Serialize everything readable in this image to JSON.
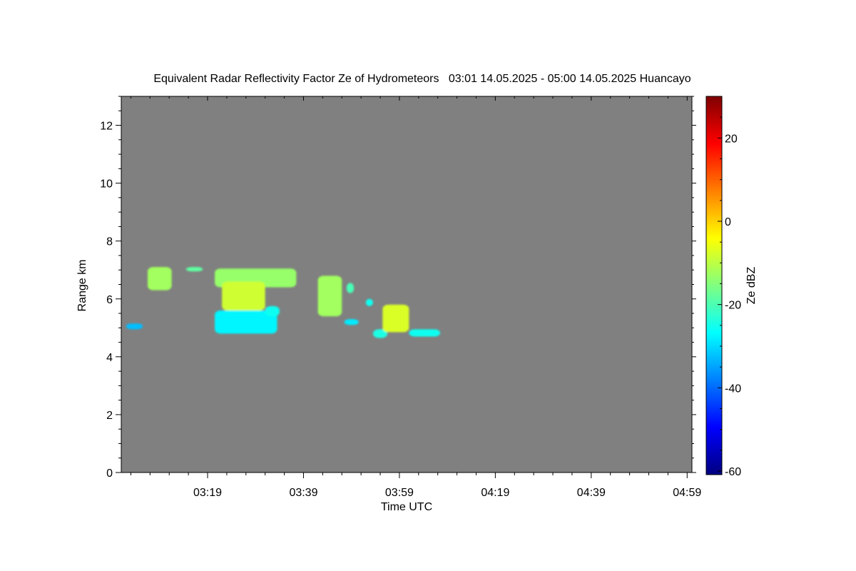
{
  "chart_data": {
    "type": "heatmap",
    "title": "Equivalent Radar Reflectivity Factor Ze of Hydrometeors   03:01 14.05.2025 - 05:00 14.05.2025 Huancayo",
    "xlabel": "Time UTC",
    "ylabel": "Range km",
    "x_ticks": [
      "03:19",
      "03:39",
      "03:59",
      "04:19",
      "04:39",
      "04:59"
    ],
    "x_tick_minutes": [
      18,
      38,
      58,
      78,
      98,
      118
    ],
    "xlim_minutes": [
      0,
      119
    ],
    "ylim": [
      0,
      13
    ],
    "y_ticks": [
      0,
      2,
      4,
      6,
      8,
      10,
      12
    ],
    "y_tick_labels": [
      "0",
      "2",
      "4",
      "6",
      "8",
      "10",
      "12"
    ],
    "colorbar": {
      "label": "Ze dBZ",
      "range": [
        -60,
        30
      ],
      "ticks": [
        -60,
        -40,
        -20,
        0,
        20
      ],
      "tick_labels": [
        "-60",
        "-40",
        "-20",
        "0",
        "20"
      ],
      "colormap": "jet"
    },
    "background_color": "#808080",
    "echoes": [
      {
        "t0": 5.5,
        "t1": 10.5,
        "r0": 6.3,
        "r1": 7.1,
        "dbz": -12
      },
      {
        "t0": 13.5,
        "t1": 17.0,
        "r0": 6.95,
        "r1": 7.1,
        "dbz": -18
      },
      {
        "t0": 19.5,
        "t1": 36.5,
        "r0": 6.4,
        "r1": 7.05,
        "dbz": -13
      },
      {
        "t0": 21.0,
        "t1": 30.0,
        "r0": 5.6,
        "r1": 6.6,
        "dbz": -8
      },
      {
        "t0": 19.5,
        "t1": 32.5,
        "r0": 4.8,
        "r1": 5.6,
        "dbz": -27
      },
      {
        "t0": 30.0,
        "t1": 33.0,
        "r0": 5.4,
        "r1": 5.75,
        "dbz": -25
      },
      {
        "t0": 1.0,
        "t1": 4.5,
        "r0": 4.95,
        "r1": 5.15,
        "dbz": -32
      },
      {
        "t0": 41.0,
        "t1": 46.0,
        "r0": 5.4,
        "r1": 6.8,
        "dbz": -12
      },
      {
        "t0": 47.0,
        "t1": 48.5,
        "r0": 6.2,
        "r1": 6.55,
        "dbz": -20
      },
      {
        "t0": 46.5,
        "t1": 49.5,
        "r0": 5.1,
        "r1": 5.3,
        "dbz": -28
      },
      {
        "t0": 51.0,
        "t1": 52.5,
        "r0": 5.75,
        "r1": 6.0,
        "dbz": -25
      },
      {
        "t0": 52.5,
        "t1": 55.5,
        "r0": 4.65,
        "r1": 4.95,
        "dbz": -24
      },
      {
        "t0": 54.5,
        "t1": 60.0,
        "r0": 4.85,
        "r1": 5.8,
        "dbz": -7
      },
      {
        "t0": 60.0,
        "t1": 66.5,
        "r0": 4.7,
        "r1": 4.95,
        "dbz": -25
      }
    ]
  }
}
